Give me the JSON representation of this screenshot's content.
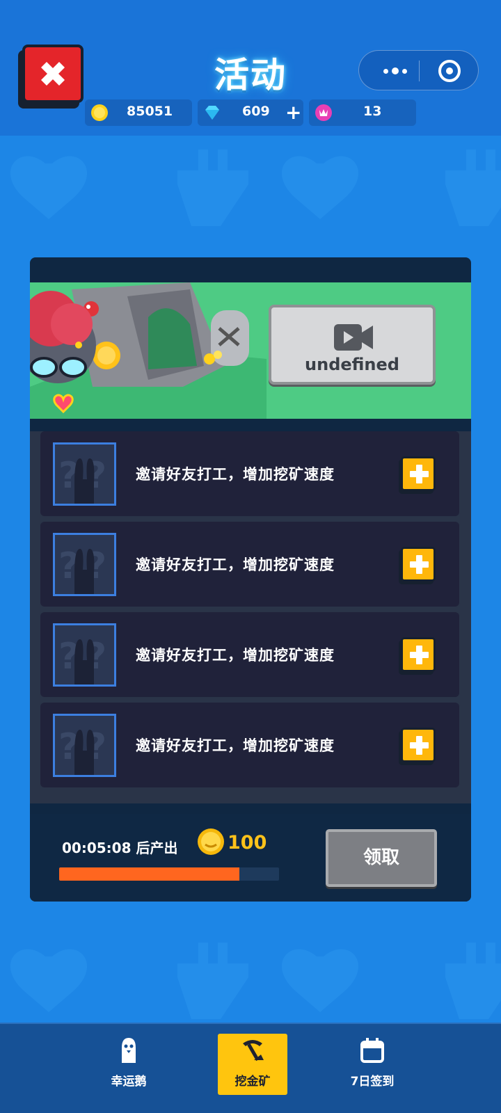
{
  "header": {
    "title": "活动",
    "resources": {
      "coins": "85051",
      "gems": "609",
      "gem_plus": "+",
      "tickets": "13"
    }
  },
  "banner": {
    "video_button_label": "undefined"
  },
  "task_list": [
    {
      "text": "邀请好友打工，增加挖矿速度"
    },
    {
      "text": "邀请好友打工，增加挖矿速度"
    },
    {
      "text": "邀请好友打工，增加挖矿速度"
    },
    {
      "text": "邀请好友打工，增加挖矿速度"
    }
  ],
  "production": {
    "timer_text": "00:05:08 后产出",
    "reward_amount": "100",
    "progress_fraction": 0.82,
    "claim_label": "领取"
  },
  "bottom_nav": [
    {
      "label": "幸运鹅",
      "icon": "goose-icon",
      "active": false
    },
    {
      "label": "挖金矿",
      "icon": "pickaxe-icon",
      "active": true
    },
    {
      "label": "7日签到",
      "icon": "calendar-icon",
      "active": false
    }
  ],
  "colors": {
    "background": "#1d86e6",
    "header": "#1a74d8",
    "accent_yellow": "#ffc50e",
    "progress": "#ff661f",
    "close_red": "#e4252a"
  }
}
